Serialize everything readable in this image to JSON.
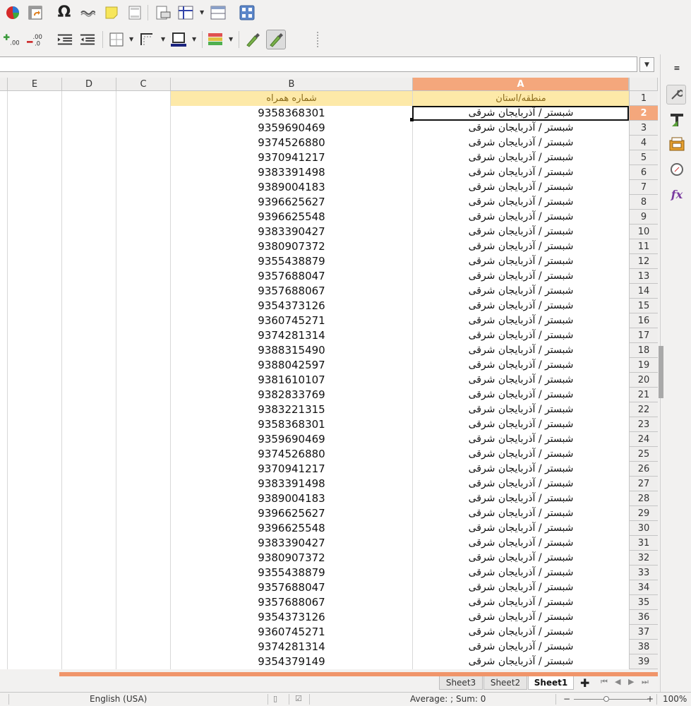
{
  "toolbar": {
    "row1_icons": [
      "chart-icon",
      "pivot-table-icon",
      "special-character-icon",
      "hyperlink-icon",
      "comment-icon",
      "headers-footers-icon",
      "print-area-icon",
      "freeze-rows-icon",
      "split-window-icon",
      "navigator-icon"
    ],
    "row2_icons": [
      "add-decimal-icon",
      "delete-decimal-icon",
      "increase-indent-icon",
      "decrease-indent-icon",
      "borders-icon",
      "border-style-icon",
      "border-color-icon",
      "conditional-format-icon",
      "show-draw-icon",
      "draw-functions-icon"
    ],
    "special_char_glyph": "Ω"
  },
  "formula_bar": {
    "value": "",
    "dropdown_glyph": "▼"
  },
  "columns": [
    {
      "label": "E"
    },
    {
      "label": "D"
    },
    {
      "label": "C"
    },
    {
      "label": "B"
    },
    {
      "label": "A"
    }
  ],
  "header_row": {
    "row_num": "1",
    "a": "منطقه/استان",
    "b": "شماره همراه"
  },
  "rows": [
    {
      "n": "2",
      "a": "شبستر / آذربایجان شرقی",
      "b": "9358368301"
    },
    {
      "n": "3",
      "a": "شبستر / آذربایجان شرقی",
      "b": "9359690469"
    },
    {
      "n": "4",
      "a": "شبستر / آذربایجان شرقی",
      "b": "9374526880"
    },
    {
      "n": "5",
      "a": "شبستر / آذربایجان شرقی",
      "b": "9370941217"
    },
    {
      "n": "6",
      "a": "شبستر / آذربایجان شرقی",
      "b": "9383391498"
    },
    {
      "n": "7",
      "a": "شبستر / آذربایجان شرقی",
      "b": "9389004183"
    },
    {
      "n": "8",
      "a": "شبستر / آذربایجان شرقی",
      "b": "9396625627"
    },
    {
      "n": "9",
      "a": "شبستر / آذربایجان شرقی",
      "b": "9396625548"
    },
    {
      "n": "10",
      "a": "شبستر / آذربایجان شرقی",
      "b": "9383390427"
    },
    {
      "n": "11",
      "a": "شبستر / آذربایجان شرقی",
      "b": "9380907372"
    },
    {
      "n": "12",
      "a": "شبستر / آذربایجان شرقی",
      "b": "9355438879"
    },
    {
      "n": "13",
      "a": "شبستر / آذربایجان شرقی",
      "b": "9357688047"
    },
    {
      "n": "14",
      "a": "شبستر / آذربایجان شرقی",
      "b": "9357688067"
    },
    {
      "n": "15",
      "a": "شبستر / آذربایجان شرقی",
      "b": "9354373126"
    },
    {
      "n": "16",
      "a": "شبستر / آذربایجان شرقی",
      "b": "9360745271"
    },
    {
      "n": "17",
      "a": "شبستر / آذربایجان شرقی",
      "b": "9374281314"
    },
    {
      "n": "18",
      "a": "شبستر / آذربایجان شرقی",
      "b": "9388315490"
    },
    {
      "n": "19",
      "a": "شبستر / آذربایجان شرقی",
      "b": "9388042597"
    },
    {
      "n": "20",
      "a": "شبستر / آذربایجان شرقی",
      "b": "9381610107"
    },
    {
      "n": "21",
      "a": "شبستر / آذربایجان شرقی",
      "b": "9382833769"
    },
    {
      "n": "22",
      "a": "شبستر / آذربایجان شرقی",
      "b": "9383221315"
    },
    {
      "n": "23",
      "a": "شبستر / آذربایجان شرقی",
      "b": "9358368301"
    },
    {
      "n": "24",
      "a": "شبستر / آذربایجان شرقی",
      "b": "9359690469"
    },
    {
      "n": "25",
      "a": "شبستر / آذربایجان شرقی",
      "b": "9374526880"
    },
    {
      "n": "26",
      "a": "شبستر / آذربایجان شرقی",
      "b": "9370941217"
    },
    {
      "n": "27",
      "a": "شبستر / آذربایجان شرقی",
      "b": "9383391498"
    },
    {
      "n": "28",
      "a": "شبستر / آذربایجان شرقی",
      "b": "9389004183"
    },
    {
      "n": "29",
      "a": "شبستر / آذربایجان شرقی",
      "b": "9396625627"
    },
    {
      "n": "30",
      "a": "شبستر / آذربایجان شرقی",
      "b": "9396625548"
    },
    {
      "n": "31",
      "a": "شبستر / آذربایجان شرقی",
      "b": "9383390427"
    },
    {
      "n": "32",
      "a": "شبستر / آذربایجان شرقی",
      "b": "9380907372"
    },
    {
      "n": "33",
      "a": "شبستر / آذربایجان شرقی",
      "b": "9355438879"
    },
    {
      "n": "34",
      "a": "شبستر / آذربایجان شرقی",
      "b": "9357688047"
    },
    {
      "n": "35",
      "a": "شبستر / آذربایجان شرقی",
      "b": "9357688067"
    },
    {
      "n": "36",
      "a": "شبستر / آذربایجان شرقی",
      "b": "9354373126"
    },
    {
      "n": "37",
      "a": "شبستر / آذربایجان شرقی",
      "b": "9360745271"
    },
    {
      "n": "38",
      "a": "شبستر / آذربایجان شرقی",
      "b": "9374281314"
    },
    {
      "n": "39",
      "a": "شبستر / آذربایجان شرقی",
      "b": "9354379149"
    }
  ],
  "selected_cell": "A2",
  "sidebar_icons": [
    "sidebar-menu-icon",
    "properties-icon",
    "styles-icon",
    "gallery-icon",
    "navigator-icon",
    "functions-icon"
  ],
  "sheet_tabs": [
    {
      "label": "Sheet3",
      "active": false
    },
    {
      "label": "Sheet2",
      "active": false
    },
    {
      "label": "Sheet1",
      "active": true
    }
  ],
  "status": {
    "language": "English (USA)",
    "summary": "Average: ; Sum: 0",
    "zoom_out": "−",
    "zoom_in": "+",
    "zoom": "100%"
  },
  "colors": {
    "accent": "#f4a77c",
    "header_fill": "#fde9a8",
    "header_text": "#8a6a1a"
  }
}
